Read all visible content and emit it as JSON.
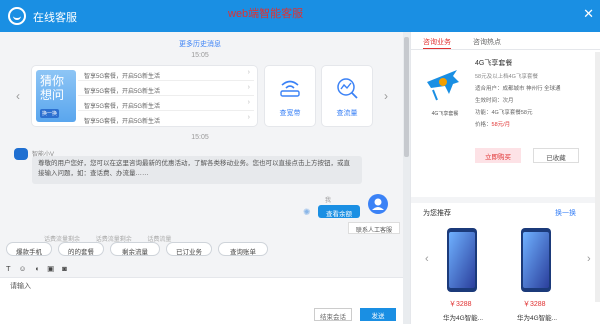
{
  "header": {
    "title": "在线客服",
    "center_title": "web端智能客服",
    "close_glyph": "✕"
  },
  "chat": {
    "history_link": "更多历史消息",
    "times": [
      "15:05",
      "15:05"
    ],
    "promo": {
      "big_text": "猜你想问",
      "tag": "换一换"
    },
    "card_rows": [
      "智享5G套餐，开启5G新生活",
      "智享5G套餐，开启5G新生活",
      "智享5G套餐，开启5G新生活",
      "智享5G套餐，开启5G新生活"
    ],
    "tiles": [
      {
        "label": "查宽带",
        "icon": "wifi-router-icon"
      },
      {
        "label": "查流量",
        "icon": "chart-search-icon"
      }
    ],
    "bot_name": "智能小V",
    "bot_message": "尊敬的用户您好，您可以在这里咨询最新的优惠活动，了解各类移动业务。您也可以直接点击上方按钮，或直接输入问题，如：查话费、办流量……",
    "user_name": "我",
    "user_message": "查看余额",
    "human_button": "联系人工客服",
    "faded_tabs": [
      "话费流量剩余",
      "话费流量剩余",
      "话费流量"
    ],
    "quick_replies": [
      "爆款手机",
      "的的套餐",
      "剩余流量",
      "已订业务",
      "查询账单"
    ],
    "toolbar_icons": [
      "text-icon",
      "emoji-icon",
      "voice-icon",
      "image-icon",
      "camera-icon"
    ],
    "input_placeholder": "请输入",
    "end_button": "结束会话",
    "send_button": "发送"
  },
  "right": {
    "tabs": [
      {
        "label": "咨询业务",
        "active": true
      },
      {
        "label": "咨询热点",
        "active": false
      }
    ],
    "plan": {
      "image_caption": "4G飞享套餐",
      "title": "4G飞享套餐",
      "subtitle": "58元及以上档4G飞享套餐",
      "lines": [
        "适合用户：成都城市  神州行  全球通",
        "生效时间：次月",
        "功能：4G飞享套餐58元"
      ],
      "price_label": "价格：",
      "price": "58元/月",
      "buy_button": "立即购买",
      "sold_button": "已收藏"
    },
    "recommend": {
      "title": "为您推荐",
      "more": "换一换",
      "products": [
        {
          "price": "￥3288",
          "name": "华为4G智能..."
        },
        {
          "price": "￥3288",
          "name": "华为4G智能..."
        }
      ]
    }
  },
  "colors": {
    "brand_blue": "#1a8fe3",
    "accent_red": "#e03131"
  }
}
